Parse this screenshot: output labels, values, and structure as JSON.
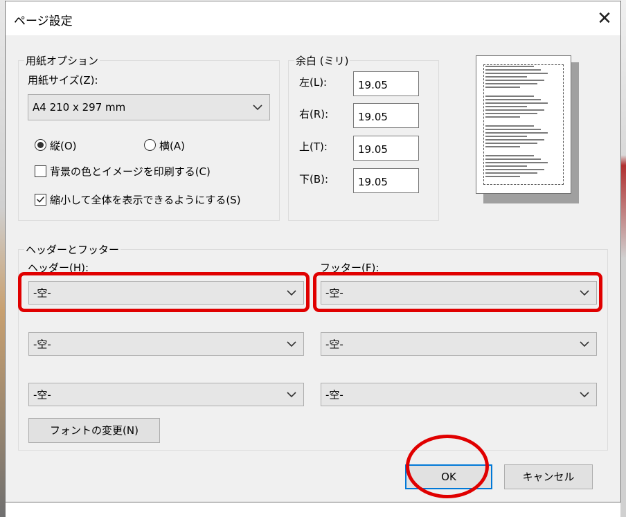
{
  "dialog": {
    "title": "ページ設定",
    "close_glyph": "✕",
    "close_icon": "close-icon"
  },
  "paper": {
    "group_label": "用紙オプション",
    "size_label": "用紙サイズ(Z):",
    "size_value": "A4 210 x 297 mm",
    "orientation": {
      "portrait_label": "縦(O)",
      "landscape_label": "横(A)",
      "selected": "portrait"
    },
    "print_background_label": "背景の色とイメージを印刷する(C)",
    "print_background_checked": false,
    "shrink_to_fit_label": "縮小して全体を表示できるようにする(S)",
    "shrink_to_fit_checked": true
  },
  "margins": {
    "group_label": "余白 (ミリ)",
    "left_label": "左(L):",
    "left_value": "19.05",
    "right_label": "右(R):",
    "right_value": "19.05",
    "top_label": "上(T):",
    "top_value": "19.05",
    "bottom_label": "下(B):",
    "bottom_value": "19.05"
  },
  "header_footer": {
    "group_label": "ヘッダーとフッター",
    "header_label": "ヘッダー(H):",
    "footer_label": "フッター(F):",
    "header_rows": [
      "-空-",
      "-空-",
      "-空-"
    ],
    "footer_rows": [
      "-空-",
      "-空-",
      "-空-"
    ],
    "font_button_label": "フォントの変更(N)"
  },
  "buttons": {
    "ok_label": "OK",
    "cancel_label": "キャンセル"
  },
  "colors": {
    "annotation_red": "#e00000",
    "focus_blue": "#0078d7"
  },
  "icons": {
    "dropdown": "chevron-down-icon",
    "radio": "radio-icon",
    "checkbox": "checkbox-icon",
    "checkmark": "check-icon"
  }
}
